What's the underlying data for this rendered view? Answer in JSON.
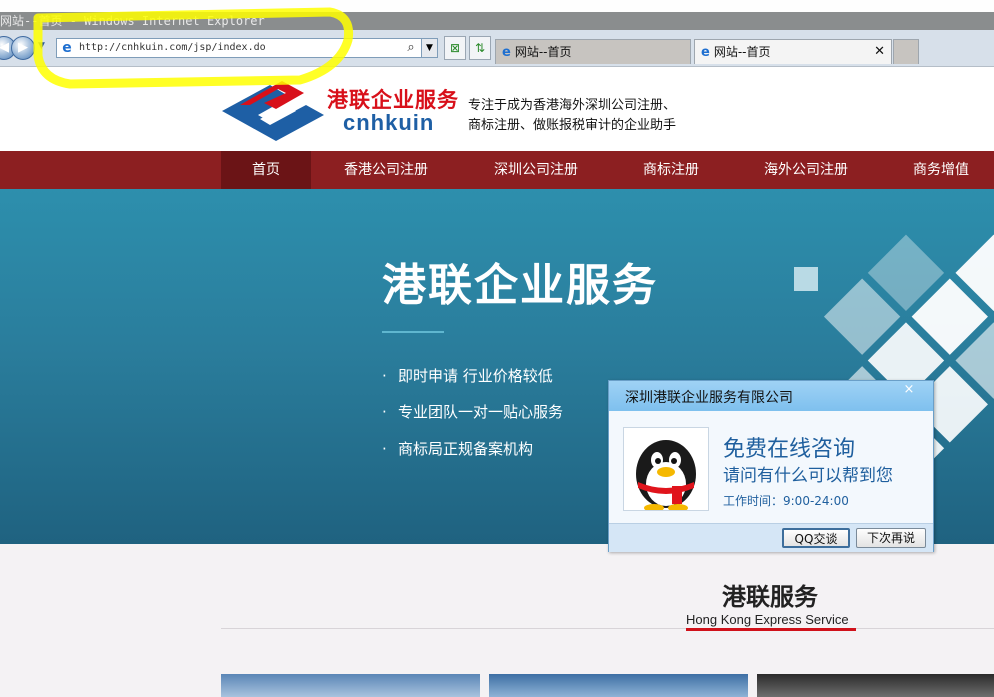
{
  "browser": {
    "window_title": "网站--首页 - Windows Internet Explorer",
    "address": "http://cnhkuin.com/jsp/index.do",
    "tabs": [
      {
        "label": "网站--首页"
      },
      {
        "label": "网站--首页"
      }
    ],
    "close_glyph": "✕"
  },
  "site": {
    "logo_cn": "港联企业服务",
    "logo_en": "cnhkuin",
    "slogan_line1": "专注于成为香港海外深圳公司注册、",
    "slogan_line2": "商标注册、做账报税审计的企业助手"
  },
  "nav": {
    "items": [
      {
        "label": "首页"
      },
      {
        "label": "香港公司注册"
      },
      {
        "label": "深圳公司注册"
      },
      {
        "label": "商标注册"
      },
      {
        "label": "海外公司注册"
      },
      {
        "label": "商务增值"
      }
    ],
    "active_index": 0
  },
  "banner": {
    "title": "港联企业服务",
    "bullets": [
      {
        "text": "即时申请 行业价格较低"
      },
      {
        "text": "专业团队一对一贴心服务"
      },
      {
        "text": "商标局正规备案机构"
      }
    ],
    "bullet_glyph": "·"
  },
  "section": {
    "title": "港联服务",
    "subtitle": "Hong Kong Express Service"
  },
  "qq_popup": {
    "title": "深圳港联企业服务有限公司",
    "close_glyph": "×",
    "headline": "免费在线咨询",
    "subline": "请问有什么可以帮到您",
    "hours": "工作时间：9:00-24:00",
    "chat_button": "QQ交谈",
    "later_button": "下次再说"
  },
  "colors": {
    "nav_bg": "#8c1f21",
    "nav_active": "#6b1416",
    "logo_red": "#d8101a",
    "logo_blue": "#1e5fa5",
    "banner_blue": "#2a7d9c",
    "highlight": "#ffff00"
  }
}
